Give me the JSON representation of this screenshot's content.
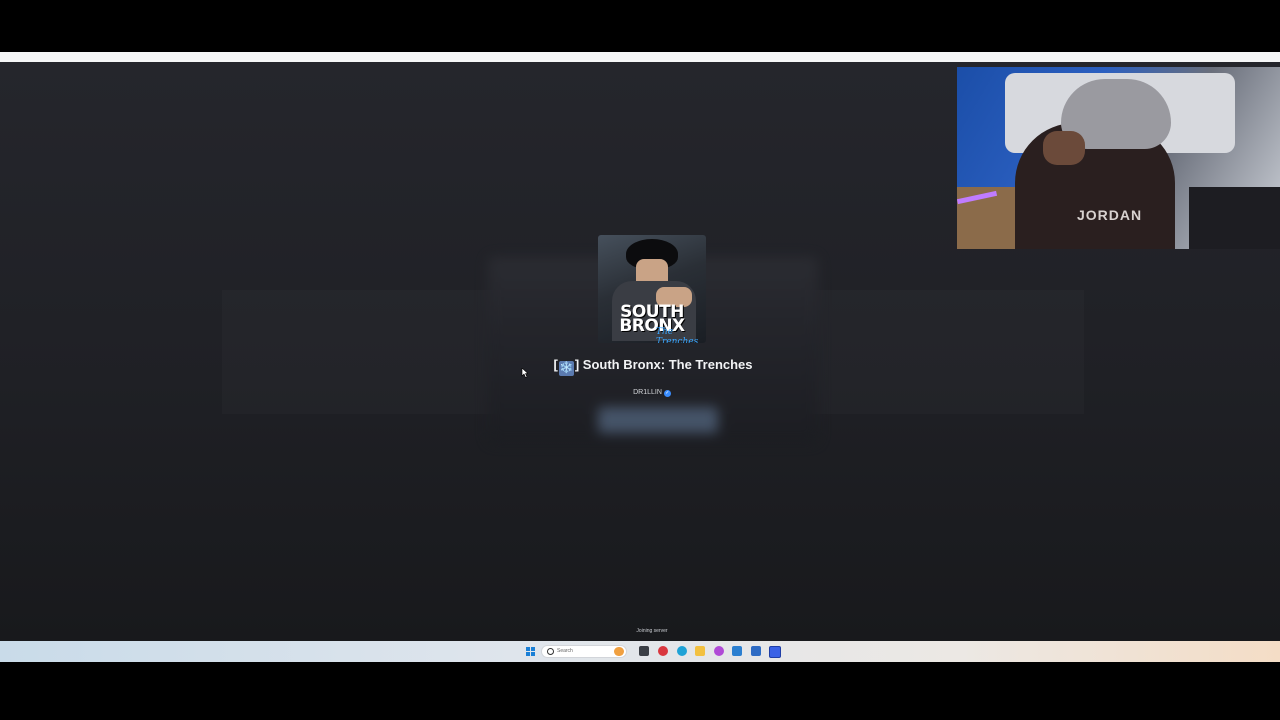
{
  "game": {
    "title_prefix": "[",
    "title_icon": "❄️",
    "title_main": "] South Bronx: The Trenches",
    "thumbnail_line1": "SOUTH",
    "thumbnail_line2": "BRONX",
    "thumbnail_subtitle": "The Trenches",
    "creator": "DR1LLIN",
    "creator_verified": true
  },
  "status": {
    "joining": "Joining server"
  },
  "webcam": {
    "shirt_text": "JORDAN"
  },
  "taskbar": {
    "search_placeholder": "Search",
    "icons": [
      "task-view-icon",
      "game-app-icon",
      "edge-icon",
      "file-explorer-icon",
      "copilot-icon",
      "store-icon",
      "mail-icon",
      "roblox-icon"
    ]
  },
  "colors": {
    "accent": "#3a8dff",
    "stage_bg": "#1f2025"
  }
}
